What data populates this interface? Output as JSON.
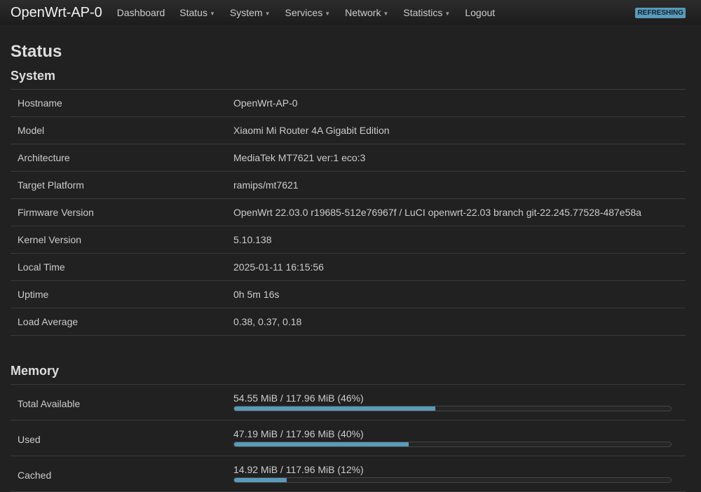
{
  "nav": {
    "brand": "OpenWrt-AP-0",
    "items": [
      "Dashboard",
      "Status",
      "System",
      "Services",
      "Network",
      "Statistics",
      "Logout"
    ],
    "badge": "REFRESHING"
  },
  "page_title": "Status",
  "system": {
    "title": "System",
    "rows": [
      [
        "Hostname",
        "OpenWrt-AP-0"
      ],
      [
        "Model",
        "Xiaomi Mi Router 4A Gigabit Edition"
      ],
      [
        "Architecture",
        "MediaTek MT7621 ver:1 eco:3"
      ],
      [
        "Target Platform",
        "ramips/mt7621"
      ],
      [
        "Firmware Version",
        "OpenWrt 22.03.0 r19685-512e76967f / LuCI openwrt-22.03 branch git-22.245.77528-487e58a"
      ],
      [
        "Kernel Version",
        "5.10.138"
      ],
      [
        "Local Time",
        "2025-01-11 16:15:56"
      ],
      [
        "Uptime",
        "0h 5m 16s"
      ],
      [
        "Load Average",
        "0.38, 0.37, 0.18"
      ]
    ]
  },
  "memory": {
    "title": "Memory",
    "rows": [
      {
        "label": "Total Available",
        "text": "54.55 MiB / 117.96 MiB (46%)",
        "percent": 46
      },
      {
        "label": "Used",
        "text": "47.19 MiB / 117.96 MiB (40%)",
        "percent": 40
      },
      {
        "label": "Cached",
        "text": "14.92 MiB / 117.96 MiB (12%)",
        "percent": 12
      }
    ]
  }
}
